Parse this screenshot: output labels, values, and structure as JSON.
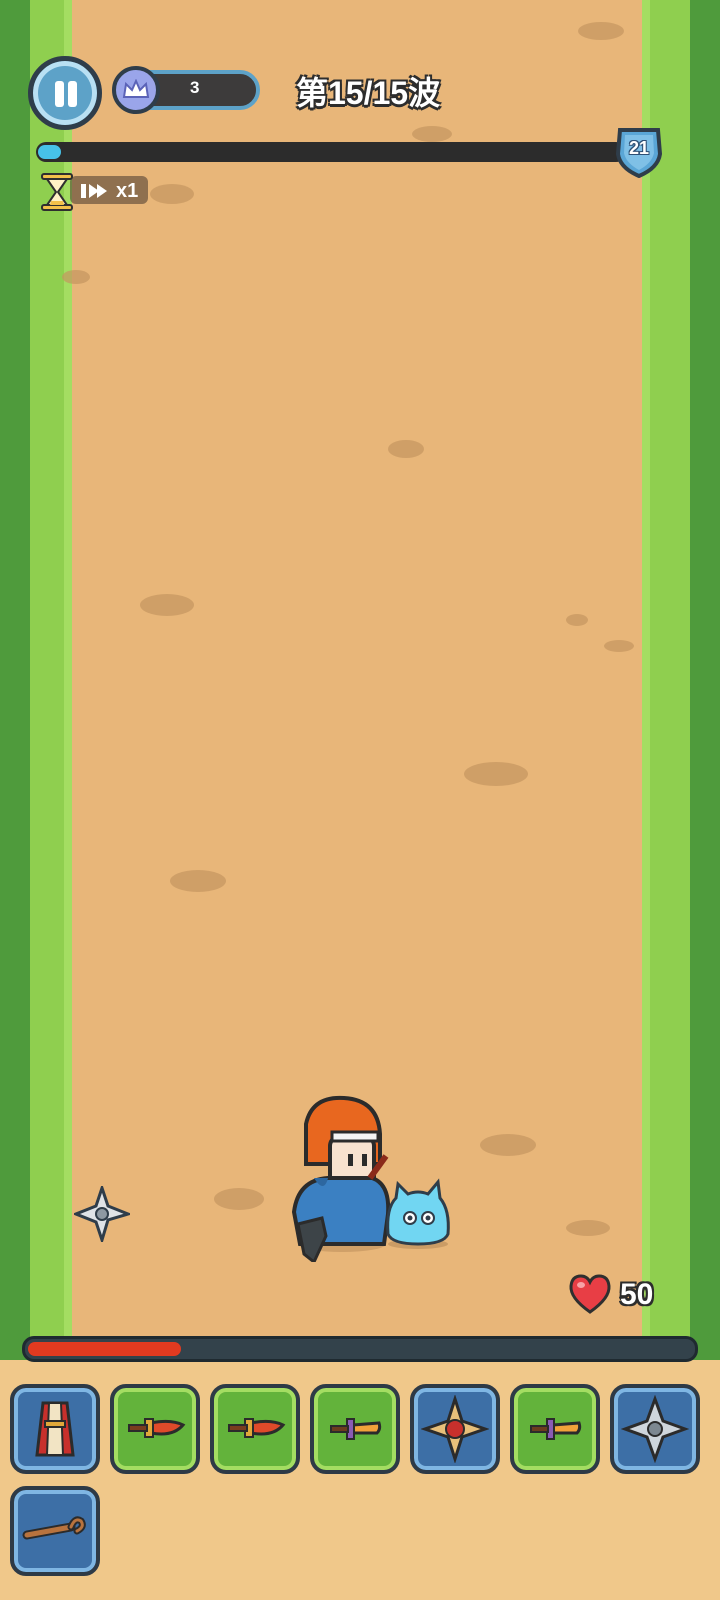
{
  "hud": {
    "crown_count": "3",
    "wave_label": "第15/15波",
    "level": "21",
    "speed_label": "x1",
    "wave_progress": 0.04
  },
  "player": {
    "hp_value": "50",
    "hp_fraction": 0.23
  },
  "inventory": {
    "slots": [
      {
        "item": "robe",
        "rarity": "blue"
      },
      {
        "item": "red-sword",
        "rarity": "green"
      },
      {
        "item": "red-sword",
        "rarity": "green"
      },
      {
        "item": "orange-dagger",
        "rarity": "green"
      },
      {
        "item": "gold-shuriken",
        "rarity": "blue"
      },
      {
        "item": "orange-dagger",
        "rarity": "green"
      },
      {
        "item": "steel-shuriken",
        "rarity": "blue"
      },
      {
        "item": "wooden-staff",
        "rarity": "blue"
      }
    ]
  },
  "colors": {
    "ground": "#e8b679",
    "grass": "#8fcf4f",
    "hp_red": "#e23a20",
    "wave_blue": "#47c2e8"
  }
}
